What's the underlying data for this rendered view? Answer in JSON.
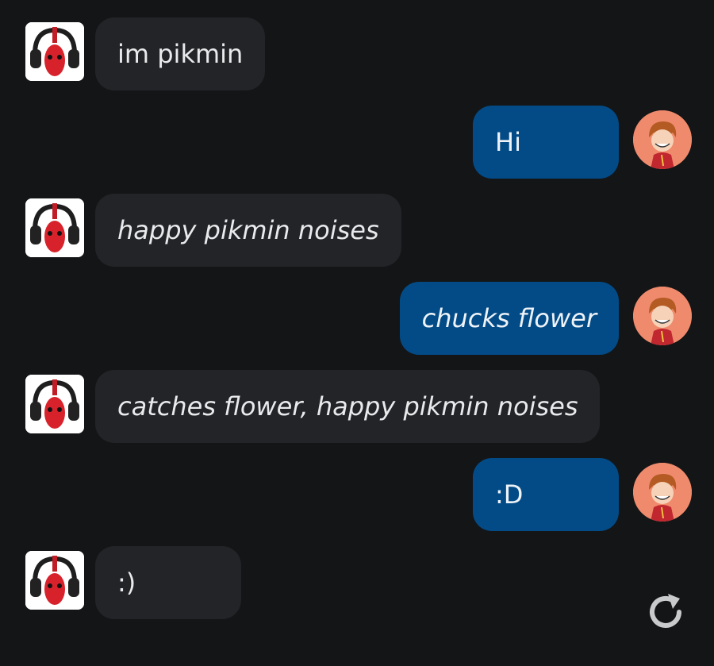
{
  "colors": {
    "background": "#141517",
    "bot_bubble": "#222427",
    "user_bubble": "#034b86",
    "text": "#e9eaec",
    "user_avatar_bg": "#f08a6c"
  },
  "messages": [
    {
      "sender": "bot",
      "text": "im pikmin",
      "italic": false
    },
    {
      "sender": "user",
      "text": "Hi",
      "italic": false
    },
    {
      "sender": "bot",
      "text": "happy pikmin noises",
      "italic": true
    },
    {
      "sender": "user",
      "text": "chucks flower",
      "italic": true
    },
    {
      "sender": "bot",
      "text": "catches flower, happy pikmin noises",
      "italic": true
    },
    {
      "sender": "user",
      "text": ":D",
      "italic": false
    },
    {
      "sender": "bot",
      "text": ":)",
      "italic": false
    }
  ],
  "icons": {
    "bot_avatar": "pikmin-headphones-avatar",
    "user_avatar": "cartoon-character-avatar",
    "regenerate": "refresh-icon"
  }
}
